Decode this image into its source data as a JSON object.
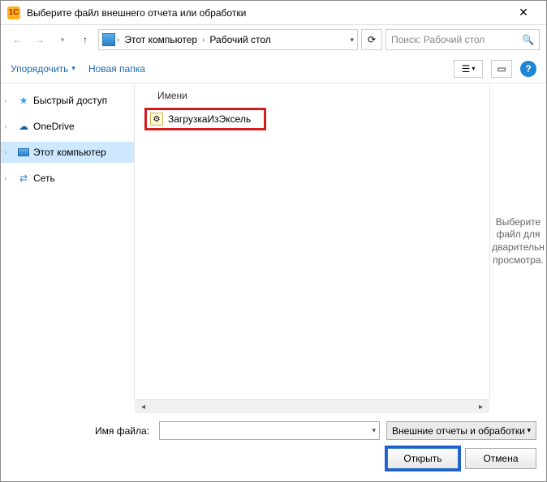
{
  "window": {
    "title": "Выберите файл внешнего отчета или обработки"
  },
  "address": {
    "crumb1": "Этот компьютер",
    "crumb2": "Рабочий стол"
  },
  "search": {
    "placeholder": "Поиск: Рабочий стол"
  },
  "toolbar": {
    "organize": "Упорядочить",
    "newfolder": "Новая папка"
  },
  "tree": {
    "quickaccess": "Быстрый доступ",
    "onedrive": "OneDrive",
    "thispc": "Этот компьютер",
    "network": "Сеть"
  },
  "files": {
    "column_name": "Имени",
    "item1": "ЗагрузкаИзЭксель"
  },
  "preview": {
    "text": "Выберите файл для дварительн просмотра."
  },
  "bottom": {
    "filename_label": "Имя файла:",
    "filter": "Внешние отчеты и обработки",
    "open": "Открыть",
    "cancel": "Отмена"
  }
}
